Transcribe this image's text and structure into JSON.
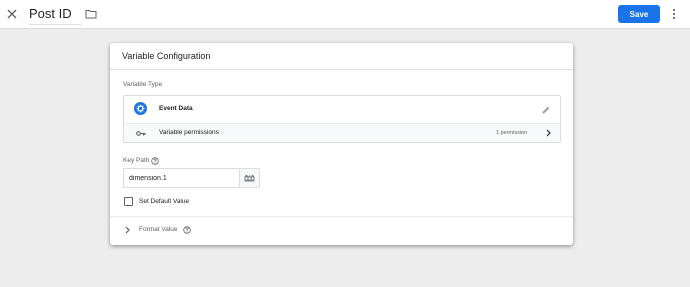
{
  "header": {
    "title": "Post ID",
    "save_label": "Save"
  },
  "card": {
    "title": "Variable Configuration",
    "variable_type_label": "Variable Type",
    "variable_type": {
      "name": "Event Data",
      "icon": "gear-icon"
    },
    "permissions": {
      "label": "Variable permissions",
      "count": "1 permission"
    },
    "key_path": {
      "label": "Key Path",
      "value": "dimension.1"
    },
    "default_value": {
      "label": "Set Default Value",
      "checked": false
    },
    "format_value": {
      "label": "Format Value"
    }
  },
  "colors": {
    "accent": "#1a73e8",
    "background": "#ededed"
  }
}
